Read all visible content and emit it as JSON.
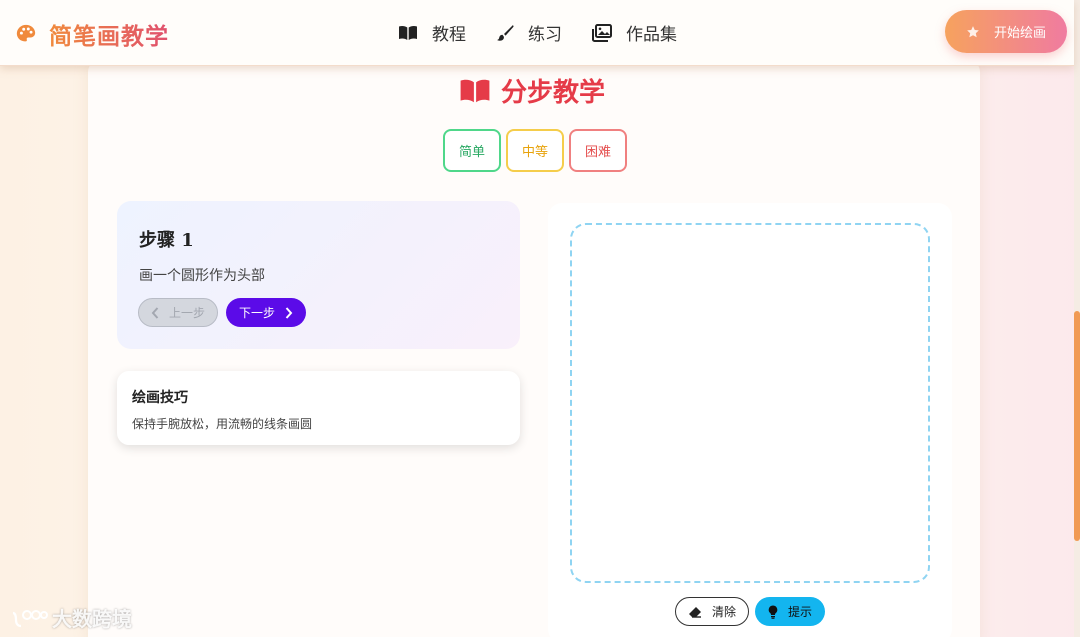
{
  "header": {
    "brand": "简笔画教学",
    "nav": [
      {
        "label": "教程",
        "icon": "book-icon"
      },
      {
        "label": "练习",
        "icon": "brush-icon"
      },
      {
        "label": "作品集",
        "icon": "images-icon"
      }
    ],
    "start_button": "开始绘画"
  },
  "main": {
    "title": "分步教学",
    "levels": [
      "简单",
      "中等",
      "困难"
    ],
    "step": {
      "title": "步骤 1",
      "description": "画一个圆形作为头部",
      "prev_label": "上一步",
      "next_label": "下一步"
    },
    "tip": {
      "title": "绘画技巧",
      "text": "保持手腕放松，用流畅的线条画圆"
    },
    "canvas": {
      "clear_label": "清除",
      "hint_label": "提示"
    }
  },
  "watermark": "大数跨境",
  "colors": {
    "accent_orange": "#f19a54",
    "title_red": "#e53b48",
    "next_purple": "#5b0be8",
    "hint_cyan": "#13b5ef"
  }
}
